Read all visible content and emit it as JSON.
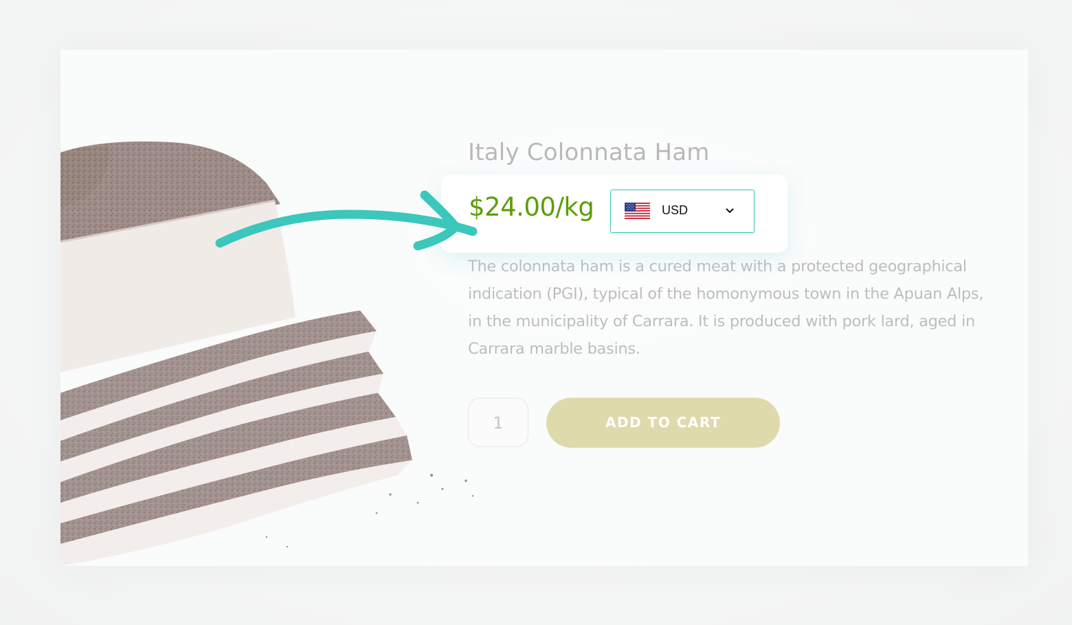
{
  "product": {
    "title": "Italy Colonnata Ham",
    "price": "$24.00/kg",
    "description": "The colonnata ham is a cured meat with a protected geographical indication (PGI), typical of the homonymous town in the Apuan Alps, in the municipality of Carrara. It is produced with pork lard, aged in Carrara marble basins.",
    "quantity": "1",
    "add_to_cart_label": "ADD TO CART"
  },
  "currency_selector": {
    "selected": "USD",
    "flag_icon": "us-flag-icon",
    "chevron_icon": "chevron-down-icon"
  },
  "colors": {
    "accent_teal": "#3cc7bc",
    "price_green": "#5a9e0a",
    "cart_button": "#dfdaac"
  }
}
